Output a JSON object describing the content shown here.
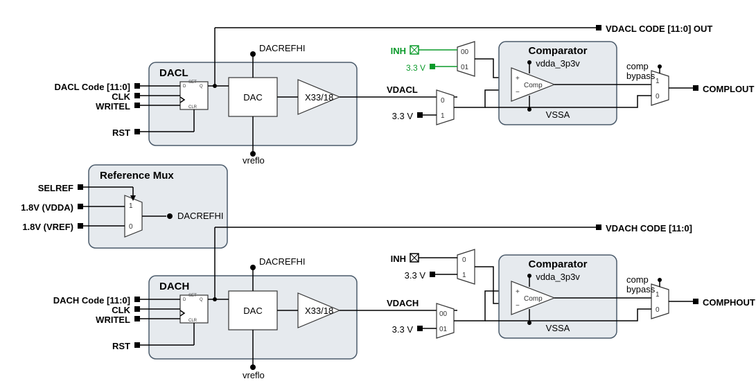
{
  "dacl": {
    "title": "DACL",
    "inputs": [
      "DACL Code [11:0]",
      "CLK",
      "WRITEL",
      "RST"
    ],
    "ref_hi": "DACREFHI",
    "ref_lo": "vreflo",
    "dac_label": "DAC",
    "gain_label": "X33/18",
    "out_signal": "VDACL",
    "code_out": "VDACL CODE [11:0] OUT"
  },
  "dach": {
    "title": "DACH",
    "inputs": [
      "DACH Code [11:0]",
      "CLK",
      "WRITEL",
      "RST"
    ],
    "ref_hi": "DACREFHI",
    "ref_lo": "vreflo",
    "dac_label": "DAC",
    "gain_label": "X33/18",
    "out_signal": "VDACH",
    "code_out": "VDACH CODE [11:0]"
  },
  "refmux": {
    "title": "Reference Mux",
    "sel": "SELREF",
    "in1": "1.8V (VDDA)",
    "in0": "1.8V (VREF)",
    "out": "DACREFHI",
    "opt1": "1",
    "opt0": "0"
  },
  "cmpL": {
    "title": "Comparator",
    "supply": "vdda_3p3v",
    "ground": "VSSA",
    "label": "Comp",
    "bypass": "comp\nbypass",
    "bypass1": "1",
    "bypass0": "0",
    "out": "COMPLOUT",
    "posmux": {
      "a": "INH",
      "b": "3.3 V",
      "opt_a": "00",
      "opt_b": "01"
    },
    "negmux": {
      "a_label": "",
      "b": "3.3 V",
      "opt_a": "0",
      "opt_b": "1"
    }
  },
  "cmpH": {
    "title": "Comparator",
    "supply": "vdda_3p3v",
    "ground": "VSSA",
    "label": "Comp",
    "bypass": "comp\nbypass",
    "bypass1": "1",
    "bypass0": "0",
    "out": "COMPHOUT",
    "posmux": {
      "a_label": "",
      "b": "3.3 V",
      "opt_a": "00",
      "opt_b": "01"
    },
    "negmux": {
      "a": "INH",
      "b": "3.3 V",
      "opt_a": "0",
      "opt_b": "1"
    }
  }
}
